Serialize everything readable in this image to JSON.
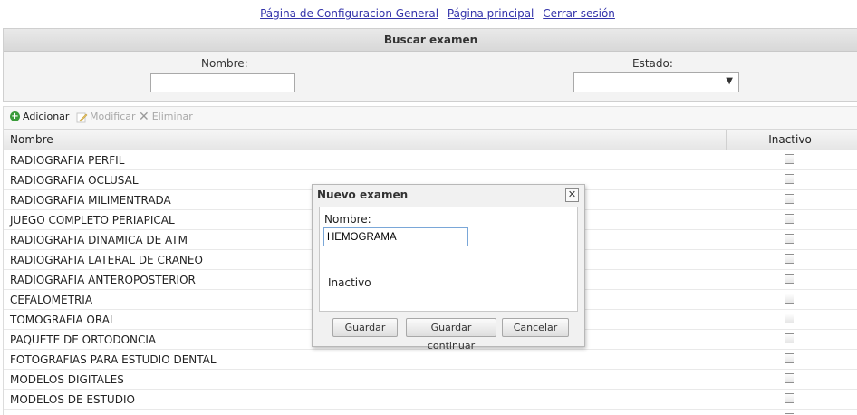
{
  "nav": {
    "config_link": "Página de Configuracion General",
    "home_link": "Página principal",
    "logout_link": "Cerrar sesión"
  },
  "search": {
    "title": "Buscar examen",
    "name_label": "Nombre:",
    "name_value": "",
    "state_label": "Estado:",
    "state_value": ""
  },
  "toolbar": {
    "add_label": "Adicionar",
    "edit_label": "Modificar",
    "delete_label": "Eliminar"
  },
  "grid": {
    "columns": [
      "Nombre",
      "Inactivo"
    ],
    "rows": [
      {
        "name": "RADIOGRAFIA PERFIL",
        "inactive": false
      },
      {
        "name": "RADIOGRAFIA OCLUSAL",
        "inactive": false
      },
      {
        "name": "RADIOGRAFIA MILIMENTRADA",
        "inactive": false
      },
      {
        "name": "JUEGO COMPLETO PERIAPICAL",
        "inactive": false
      },
      {
        "name": "RADIOGRAFIA DINAMICA DE ATM",
        "inactive": false
      },
      {
        "name": "RADIOGRAFIA LATERAL DE CRANEO",
        "inactive": false
      },
      {
        "name": "RADIOGRAFIA ANTEROPOSTERIOR",
        "inactive": false
      },
      {
        "name": "CEFALOMETRIA",
        "inactive": false
      },
      {
        "name": "TOMOGRAFIA ORAL",
        "inactive": false
      },
      {
        "name": "PAQUETE DE ORTODONCIA",
        "inactive": false
      },
      {
        "name": "FOTOGRAFIAS PARA ESTUDIO DENTAL",
        "inactive": false
      },
      {
        "name": "MODELOS DIGITALES",
        "inactive": false
      },
      {
        "name": "MODELOS DE ESTUDIO",
        "inactive": false
      },
      {
        "name": "",
        "inactive": false
      }
    ]
  },
  "dialog": {
    "title": "Nuevo examen",
    "name_label": "Nombre:",
    "name_value": "HEMOGRAMA",
    "inactive_label": "Inactivo",
    "save_label": "Guardar",
    "save_continue_label": "Guardar continuar",
    "cancel_label": "Cancelar"
  }
}
